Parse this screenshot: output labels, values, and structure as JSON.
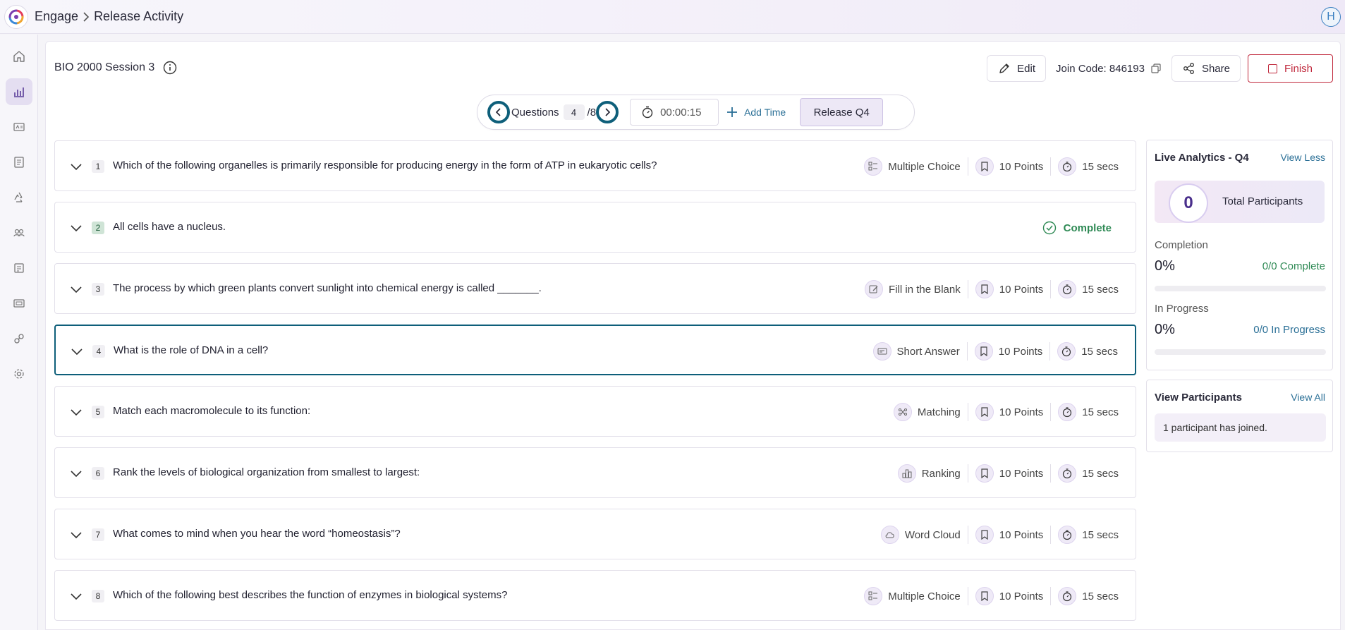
{
  "topbar": {
    "app_name": "Engage",
    "page_name": "Release Activity",
    "avatar_initial": "H"
  },
  "session": {
    "title": "BIO 2000 Session 3"
  },
  "header": {
    "edit_label": "Edit",
    "join_code_label": "Join Code: 846193",
    "share_label": "Share",
    "finish_label": "Finish"
  },
  "qnav": {
    "questions_label": "Questions",
    "current": "4",
    "total": "/8",
    "timer": "00:00:15",
    "add_time_label": "Add Time",
    "release_label": "Release Q4"
  },
  "questions": [
    {
      "num": "1",
      "text": "Which of the following organelles is primarily responsible for producing energy in the form of ATP in eukaryotic cells?",
      "type": "Multiple Choice",
      "points": "10 Points",
      "time": "15 secs"
    },
    {
      "num": "2",
      "text": "All cells have a nucleus.",
      "status": "Complete"
    },
    {
      "num": "3",
      "text": "The process by which green plants convert sunlight into chemical energy is called _______.",
      "type": "Fill in the Blank",
      "points": "10 Points",
      "time": "15 secs"
    },
    {
      "num": "4",
      "text": "What is the role of DNA in a cell?",
      "type": "Short Answer",
      "points": "10 Points",
      "time": "15 secs"
    },
    {
      "num": "5",
      "text": "Match each macromolecule to its function:",
      "type": "Matching",
      "points": "10 Points",
      "time": "15 secs"
    },
    {
      "num": "6",
      "text": "Rank the levels of biological organization from smallest to largest:",
      "type": "Ranking",
      "points": "10 Points",
      "time": "15 secs"
    },
    {
      "num": "7",
      "text": "What comes to mind when you hear the word “homeostasis”?",
      "type": "Word Cloud",
      "points": "10 Points",
      "time": "15 secs"
    },
    {
      "num": "8",
      "text": "Which of the following best describes the function of enzymes in biological systems?",
      "type": "Multiple Choice",
      "points": "10 Points",
      "time": "15 secs"
    }
  ],
  "analytics": {
    "title": "Live Analytics - Q4",
    "view_less_label": "View Less",
    "total_participants_value": "0",
    "total_participants_label": "Total Participants",
    "completion_label": "Completion",
    "completion_pct": "0%",
    "completion_stat": "0/0 Complete",
    "completion_fraction": 0,
    "in_progress_label": "In Progress",
    "in_progress_pct": "0%",
    "in_progress_stat": "0/0 In Progress",
    "in_progress_fraction": 0
  },
  "participants": {
    "title": "View Participants",
    "view_all_label": "View All",
    "joined_text": "1 participant has joined."
  },
  "colors": {
    "accent_teal": "#0e5f7a",
    "finish_red": "#c0283c",
    "complete_green": "#2f8a55",
    "link_blue": "#2a6f96"
  },
  "icons": {
    "sidebar": [
      "home-icon",
      "analytics-icon",
      "id-card-icon",
      "document-icon",
      "recycle-icon",
      "people-icon",
      "list-icon",
      "gallery-icon",
      "integrations-icon",
      "settings-icon"
    ]
  }
}
